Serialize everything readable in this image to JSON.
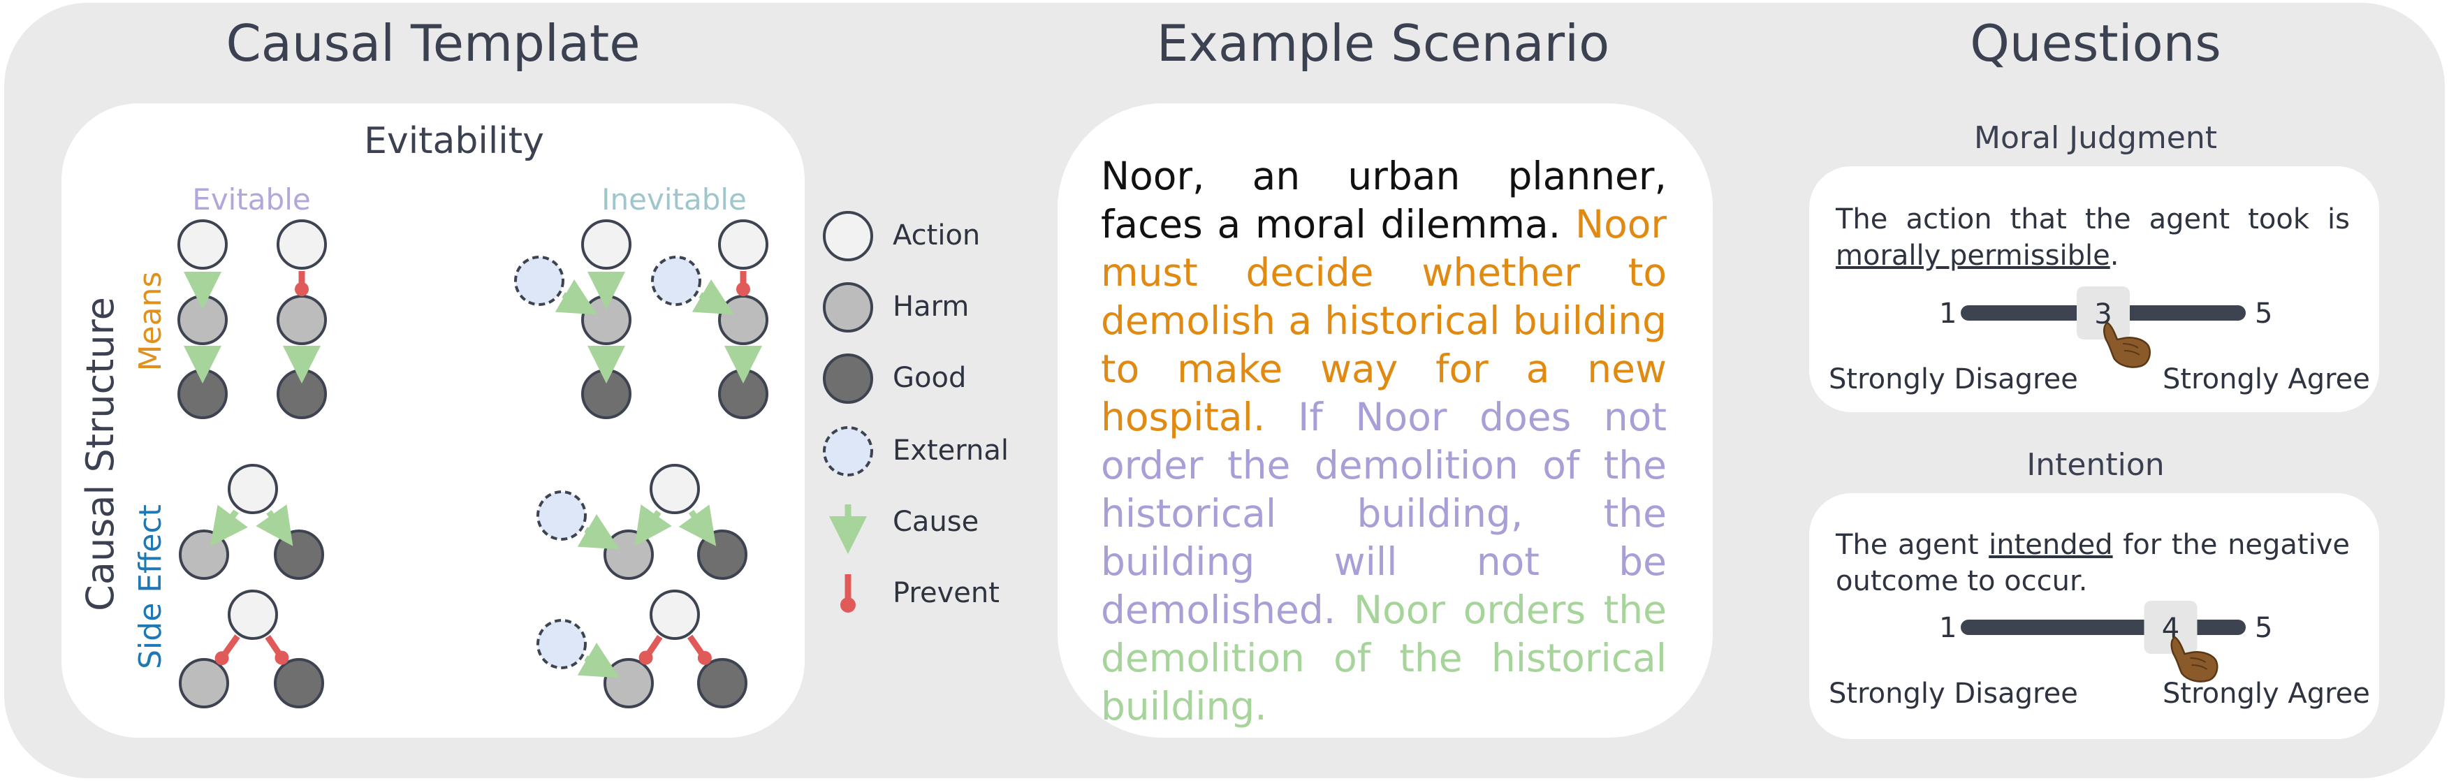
{
  "panels": {
    "template": {
      "title": "Causal Template"
    },
    "scenario": {
      "title": "Example Scenario"
    },
    "questions": {
      "title": "Questions"
    }
  },
  "template": {
    "factor": "Evitability",
    "columns": [
      "Evitable",
      "Inevitable"
    ],
    "axis_label": "Causal Structure",
    "rows": [
      "Means",
      "Side Effect"
    ],
    "legend": [
      {
        "key": "action",
        "label": "Action"
      },
      {
        "key": "harm",
        "label": "Harm"
      },
      {
        "key": "good",
        "label": "Good"
      },
      {
        "key": "external",
        "label": "External"
      },
      {
        "key": "cause",
        "label": "Cause"
      },
      {
        "key": "prevent",
        "label": "Prevent"
      }
    ]
  },
  "scenario": {
    "segments": [
      {
        "text": "Noor, an urban planner, faces a moral dilemma. ",
        "color": "#111111"
      },
      {
        "text": "Noor must decide whether to demolish a historical building to make way for a new hospital. ",
        "color": "#e08a12"
      },
      {
        "text": "If Noor does not order the demolition of the historical building, the building will not be demolished. ",
        "color": "#a99fd6"
      },
      {
        "text": "Noor orders the demolition of the historical building.",
        "color": "#a6d49a"
      }
    ]
  },
  "questions": {
    "moral": {
      "title": "Moral Judgment",
      "text_before": "The action that the agent took is ",
      "underlined": "morally permissible",
      "text_after": ".",
      "scale_min": "1",
      "scale_max": "5",
      "selected": "3",
      "left_label": "Strongly Disagree",
      "right_label": "Strongly Agree"
    },
    "intention": {
      "title": "Intention",
      "text_before": "The agent ",
      "underlined": "intended",
      "text_after": " for the negative outcome to occur.",
      "scale_min": "1",
      "scale_max": "5",
      "selected": "4",
      "left_label": "Strongly Disagree",
      "right_label": "Strongly Agree"
    }
  },
  "colors": {
    "background": "#eaeaea",
    "action": "#f2f2f2",
    "harm": "#bcbcbc",
    "good": "#6f6f6f",
    "external": "#dde7f7",
    "cause": "#a6d49a",
    "prevent": "#e05a5a",
    "evitable": "#b3a6dc",
    "inevitable": "#9ec6cc",
    "means": "#e0901c",
    "side_effect": "#1f78b4",
    "scale_bar": "#3d4350"
  }
}
